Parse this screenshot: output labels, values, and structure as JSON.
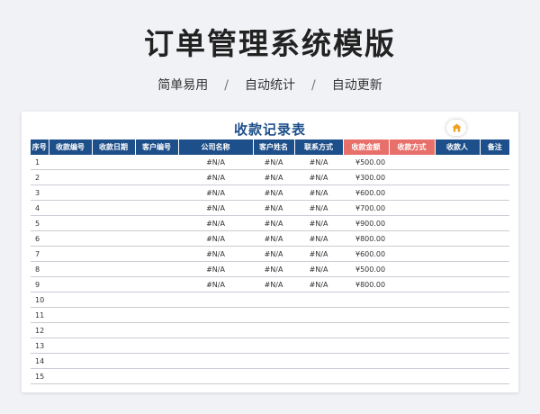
{
  "header": {
    "title": "订单管理系统模版",
    "features": [
      "简单易用",
      "自动统计",
      "自动更新"
    ],
    "separator": "/"
  },
  "table": {
    "title": "收款记录表",
    "badge_icon": "house-icon",
    "accent_color": "#1d4f8a",
    "highlight_color": "#e8706b",
    "columns": [
      "序号",
      "收款编号",
      "收款日期",
      "客户编号",
      "公司名称",
      "客户姓名",
      "联系方式",
      "收款金额",
      "收款方式",
      "收款人",
      "备注"
    ],
    "rows": [
      {
        "idx": "1",
        "company": "#N/A",
        "customer": "#N/A",
        "contact": "#N/A",
        "amount": "¥500.00"
      },
      {
        "idx": "2",
        "company": "#N/A",
        "customer": "#N/A",
        "contact": "#N/A",
        "amount": "¥300.00"
      },
      {
        "idx": "3",
        "company": "#N/A",
        "customer": "#N/A",
        "contact": "#N/A",
        "amount": "¥600.00"
      },
      {
        "idx": "4",
        "company": "#N/A",
        "customer": "#N/A",
        "contact": "#N/A",
        "amount": "¥700.00"
      },
      {
        "idx": "5",
        "company": "#N/A",
        "customer": "#N/A",
        "contact": "#N/A",
        "amount": "¥900.00"
      },
      {
        "idx": "6",
        "company": "#N/A",
        "customer": "#N/A",
        "contact": "#N/A",
        "amount": "¥800.00"
      },
      {
        "idx": "7",
        "company": "#N/A",
        "customer": "#N/A",
        "contact": "#N/A",
        "amount": "¥600.00"
      },
      {
        "idx": "8",
        "company": "#N/A",
        "customer": "#N/A",
        "contact": "#N/A",
        "amount": "¥500.00"
      },
      {
        "idx": "9",
        "company": "#N/A",
        "customer": "#N/A",
        "contact": "#N/A",
        "amount": "¥800.00"
      },
      {
        "idx": "10",
        "company": "",
        "customer": "",
        "contact": "",
        "amount": ""
      },
      {
        "idx": "11",
        "company": "",
        "customer": "",
        "contact": "",
        "amount": ""
      },
      {
        "idx": "12",
        "company": "",
        "customer": "",
        "contact": "",
        "amount": ""
      },
      {
        "idx": "13",
        "company": "",
        "customer": "",
        "contact": "",
        "amount": ""
      },
      {
        "idx": "14",
        "company": "",
        "customer": "",
        "contact": "",
        "amount": ""
      },
      {
        "idx": "15",
        "company": "",
        "customer": "",
        "contact": "",
        "amount": ""
      }
    ]
  }
}
